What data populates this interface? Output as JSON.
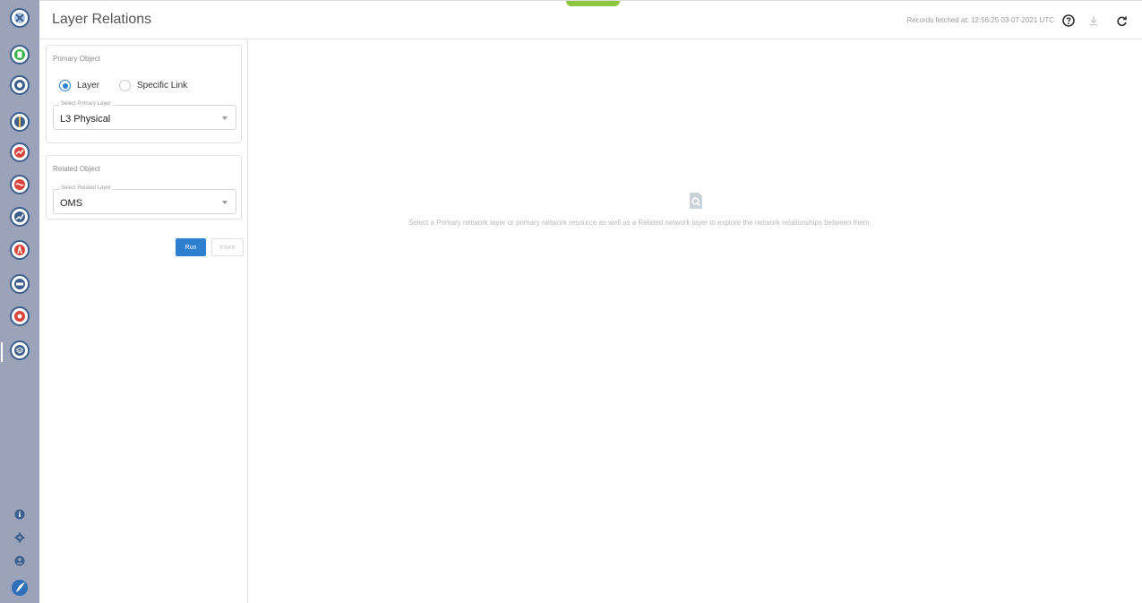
{
  "app": {
    "title": "Layer Relations"
  },
  "topbar": {
    "records_label": "Records fetched at: 12:56:25 03-07-2021 UTC",
    "icons": [
      "help-icon",
      "download-icon",
      "refresh-icon"
    ]
  },
  "nav_rail": {
    "items": [
      {
        "icon": "app-logo-icon",
        "color": "#3e5e8c"
      },
      {
        "icon": "document-icon",
        "color": "#3ab04b"
      },
      {
        "icon": "compass-icon",
        "color": "#3e5e8c"
      },
      {
        "icon": "globe-icon",
        "color": "#3e5e8c"
      },
      {
        "icon": "chart-icon",
        "color": "#d9443c"
      },
      {
        "icon": "route-icon",
        "color": "#d9443c"
      },
      {
        "icon": "trend-icon",
        "color": "#3e5e8c"
      },
      {
        "icon": "signal-icon",
        "color": "#d9443c"
      },
      {
        "icon": "sho-icon",
        "color": "#3e5e8c"
      },
      {
        "icon": "inspect-icon",
        "color": "#d9443c"
      },
      {
        "icon": "layers-icon",
        "color": "#3e5e8c"
      }
    ],
    "bottom_icons": [
      "info-icon",
      "settings-icon",
      "user-icon",
      "brand-logo-icon"
    ]
  },
  "primary": {
    "title": "Primary Object",
    "radio_layer": "Layer",
    "radio_specific_link": "Specific Link",
    "selected_radio": "Layer",
    "select_label": "Select Primary Layer",
    "select_value": "L3 Physical"
  },
  "related": {
    "title": "Related Object",
    "select_label": "Select Related Layer",
    "select_value": "OMS"
  },
  "actions": {
    "run": "Run",
    "invert": "Invert"
  },
  "empty_state": {
    "message": "Select a Primary network layer or primary network resource as well as a Related network layer to explore the network relationships between them."
  },
  "colors": {
    "accent": "#2f7fd1",
    "rail": "#9aa3ba",
    "green_tab": "#8cc63f"
  }
}
